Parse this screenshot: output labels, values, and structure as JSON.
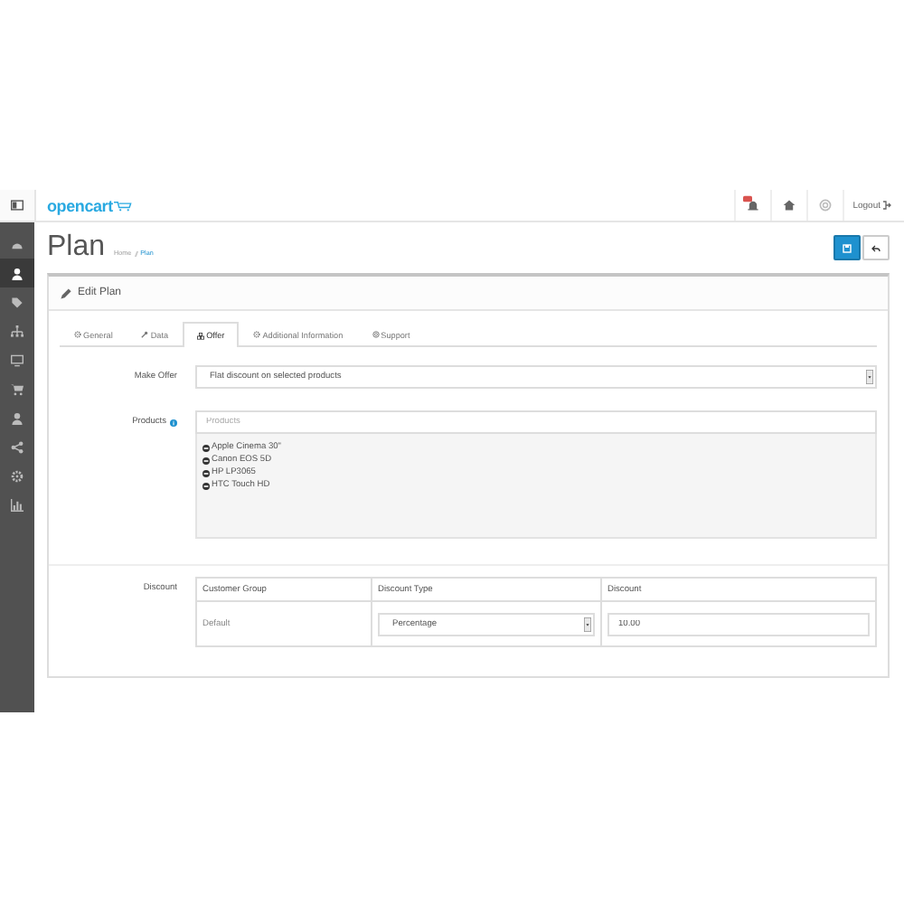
{
  "header": {
    "logo": "opencart",
    "logout": "Logout"
  },
  "sidebar": {
    "items": [
      {
        "kind": "dashboard",
        "selected": false
      },
      {
        "kind": "user",
        "selected": true
      },
      {
        "kind": "tag",
        "selected": false
      },
      {
        "kind": "sitemap",
        "selected": false
      },
      {
        "kind": "monitor",
        "selected": false
      },
      {
        "kind": "cart",
        "selected": false
      },
      {
        "kind": "user",
        "selected": false
      },
      {
        "kind": "share",
        "selected": false
      },
      {
        "kind": "gear",
        "selected": false
      },
      {
        "kind": "chart",
        "selected": false
      }
    ]
  },
  "page": {
    "title": "Plan",
    "breadcrumb": [
      "Home",
      "Plan"
    ]
  },
  "panel": {
    "title": "Edit Plan"
  },
  "tabs": [
    {
      "label": "General",
      "kind": "gear",
      "selected": false
    },
    {
      "label": "Data",
      "kind": "wrench",
      "selected": false
    },
    {
      "label": "Offer",
      "kind": "cubes",
      "selected": true
    },
    {
      "label": "Additional Information",
      "kind": "gear",
      "selected": false
    },
    {
      "label": "Support",
      "kind": "lifering",
      "selected": false
    }
  ],
  "form": {
    "make_offer": {
      "label": "Make Offer",
      "value": "Flat discount on selected products"
    },
    "products": {
      "label": "Products",
      "placeholder": "Products",
      "items": [
        "Apple Cinema 30\"",
        "Canon EOS 5D",
        "HP LP3065",
        "HTC Touch HD"
      ]
    },
    "discount": {
      "label": "Discount",
      "columns": [
        "Customer Group",
        "Discount Type",
        "Discount"
      ],
      "rows": [
        {
          "customer_group": "Default",
          "discount_type": "Percentage",
          "discount": "10.00"
        }
      ]
    }
  }
}
